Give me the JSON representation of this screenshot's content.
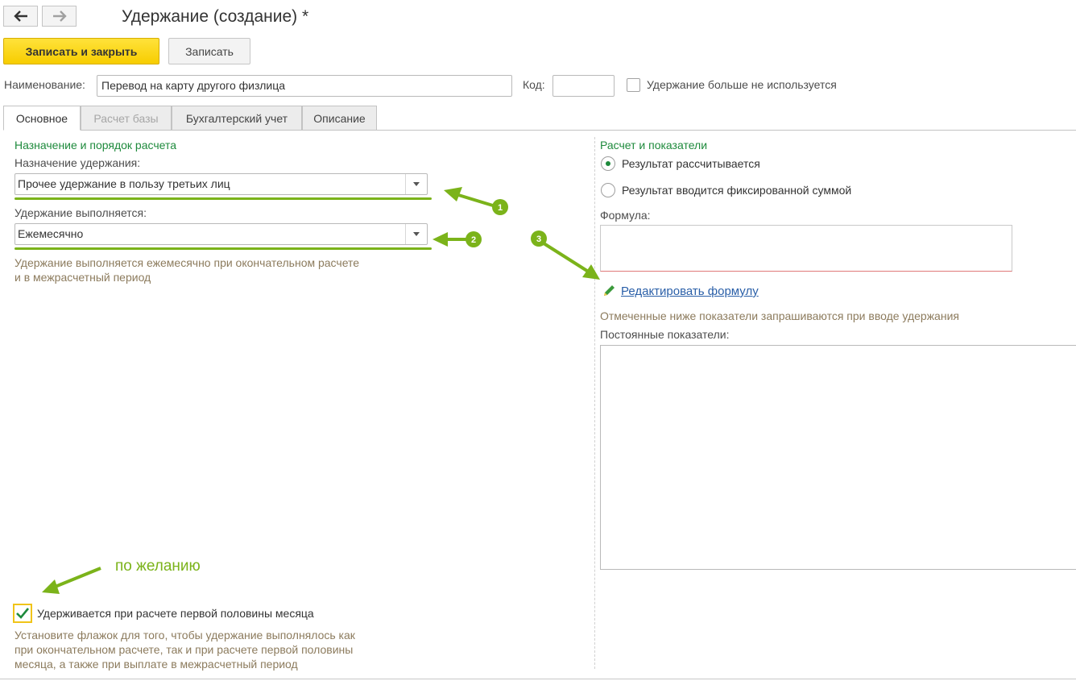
{
  "window": {
    "title": "Удержание (создание) *"
  },
  "toolbar": {
    "save_close_label": "Записать и закрыть",
    "save_label": "Записать"
  },
  "header": {
    "name_label": "Наименование:",
    "name_value": "Перевод на карту другого физлица",
    "code_label": "Код:",
    "code_value": "",
    "not_used_label": "Удержание больше не используется"
  },
  "tabs": [
    {
      "label": "Основное",
      "state": "active"
    },
    {
      "label": "Расчет базы",
      "state": "disabled"
    },
    {
      "label": "Бухгалтерский учет",
      "state": "normal"
    },
    {
      "label": "Описание",
      "state": "normal"
    }
  ],
  "left": {
    "group_title": "Назначение и порядок расчета",
    "purpose_label": "Назначение удержания:",
    "purpose_value": "Прочее удержание в пользу третьих лиц",
    "performed_label": "Удержание выполняется:",
    "performed_value": "Ежемесячно",
    "performed_hint_1": "Удержание выполняется ежемесячно при окончательном расчете",
    "performed_hint_2": "и в межрасчетный период",
    "first_half_label": "Удерживается при расчете первой половины месяца",
    "first_half_checked": true,
    "first_half_hint_1": "Установите флажок для того, чтобы удержание выполнялось как",
    "first_half_hint_2": "при окончательном расчете, так и при расчете первой половины",
    "first_half_hint_3": "месяца, а также при выплате в межрасчетный период"
  },
  "right": {
    "group_title": "Расчет и показатели",
    "radio_calculated": "Результат рассчитывается",
    "radio_fixed": "Результат вводится фиксированной суммой",
    "selected_radio": "calculated",
    "formula_label": "Формула:",
    "formula_value": "",
    "edit_formula_link": "Редактировать формулу",
    "indicators_hint": "Отмеченные ниже показатели запрашиваются при вводе удержания",
    "const_indicators_label": "Постоянные показатели:"
  },
  "annotations": {
    "marker_1": "1",
    "marker_2": "2",
    "marker_3": "3",
    "optional_note": "по желанию"
  },
  "colors": {
    "accent_green": "#1e8a3c",
    "annotation_green": "#7bb31a",
    "primary_button": "#f7cd00",
    "link": "#2a5fa8",
    "hint": "#8c7b5d"
  }
}
